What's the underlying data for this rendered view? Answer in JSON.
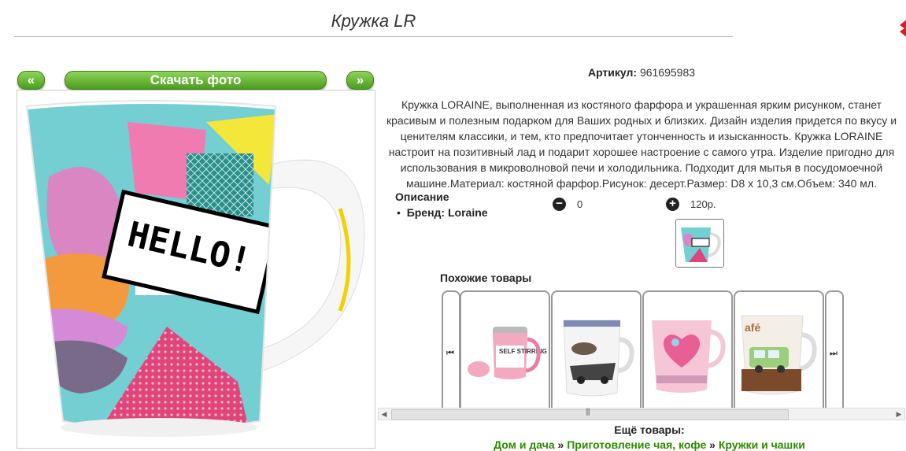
{
  "product": {
    "title": "Кружка LR",
    "sku_label": "Артикул:",
    "sku_value": "961695983",
    "description": "Кружка LORAINE, выполненная из костяного фарфора и украшенная ярким рисунком, станет красивым и полезным подарком для Ваших родных и близких. Дизайн изделия придется по вкусу и ценителям классики, и тем, кто предпочитает утонченность и изысканность. Кружка LORAINE настроит на позитивный лад и подарит хорошее настроение с самого утра. Изделие пригодно для использования в микроволновой печи и холодильника. Подходит для мытья в посудомоечной машине.Материал: костяной фарфор.Рисунок: десерт.Размер: D8 х 10,3 см.Объем: 340 мл.",
    "specs_heading": "Описание",
    "brand_label": "Бренд:",
    "brand_value": "Loraine"
  },
  "gallery": {
    "prev_label": "«",
    "download_label": "Скачать фото",
    "next_label": "»",
    "mug_text": "HELLO!"
  },
  "controls": {
    "minus_icon": "minus-circle-icon",
    "minus_value": "0",
    "plus_icon": "plus-circle-icon",
    "plus_value": "120р."
  },
  "similar": {
    "heading": "Похожие товары",
    "items": [
      {
        "name": "self-stirring-mug",
        "text": "SELF STIRRING MUG"
      },
      {
        "name": "car-pattern-mug",
        "text": ""
      },
      {
        "name": "pink-heart-mug",
        "text": ""
      },
      {
        "name": "cafe-car-mug",
        "text": ""
      }
    ]
  },
  "more": {
    "heading": "Ещё товары:",
    "crumbs": [
      "Дом и дача",
      "Приготовление чая, кофе",
      "Кружки и чашки"
    ],
    "separator": "»"
  },
  "colors": {
    "accent_green": "#4a9d1c",
    "link_green": "#2e8b00",
    "corner_red": "#d0202a"
  }
}
